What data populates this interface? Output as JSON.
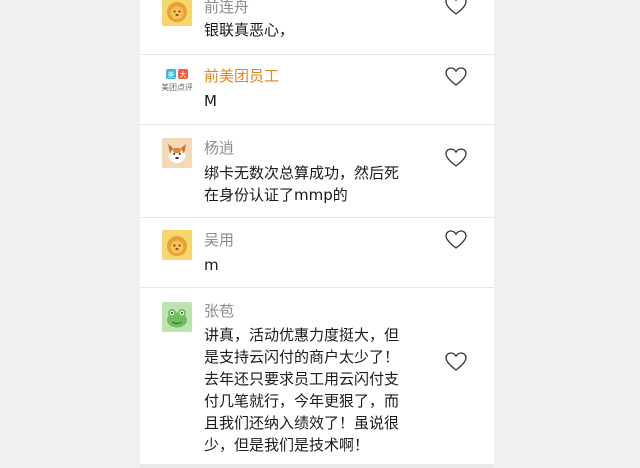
{
  "comments": [
    {
      "user": "前连舟",
      "avatar": "lion-avatar",
      "lines": [
        "银联真恶心，"
      ]
    },
    {
      "user": "前美团员工",
      "avatar": "meituan-dianping-logo",
      "avatar_caption": "美团点评",
      "lines": [
        "M"
      ]
    },
    {
      "user": "杨逍",
      "avatar": "dog-avatar",
      "lines": [
        "绑卡无数次总算成功，然后死",
        "在身份认证了mmp的"
      ]
    },
    {
      "user": "吴用",
      "avatar": "lion-avatar",
      "lines": [
        "m"
      ]
    },
    {
      "user": "张苞",
      "avatar": "frog-avatar",
      "lines": [
        "讲真，活动优惠力度挺大，但",
        "是支持云闪付的商户太少了！",
        "去年还只要求员工用云闪付支",
        "付几笔就行，今年更狠了，而",
        "且我们还纳入绩效了！虽说很",
        "少，但是我们是技术啊！"
      ]
    }
  ],
  "colors": {
    "username": "#8c8c8c",
    "employee_username": "#e8841c",
    "text": "#1a1a1a",
    "divider": "#e6e6e6"
  }
}
